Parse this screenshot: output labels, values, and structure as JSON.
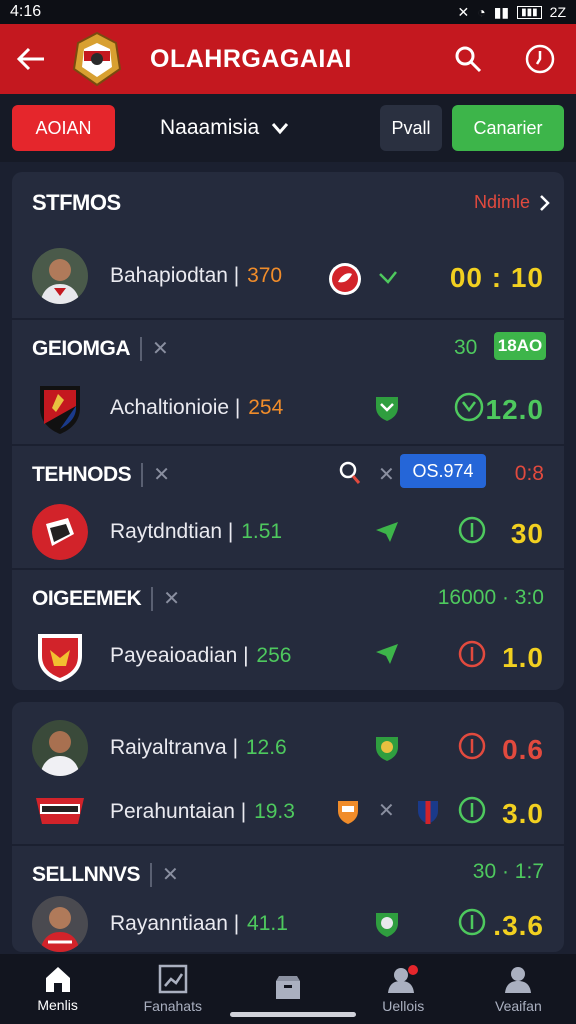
{
  "status_bar": {
    "time": "4:16",
    "battery": "2Z"
  },
  "app_bar": {
    "title": "OLAHRGAGAIAI"
  },
  "filters": {
    "red_pill": "AOIAN",
    "dropdown": "Naaamisia",
    "dark_pill": "Pvall",
    "green_pill": "Canarier"
  },
  "card1": {
    "header": {
      "label": "STFMOS",
      "link": "Ndimle"
    },
    "row1": {
      "name": "Bahapiodtan",
      "num": "370",
      "score": "00 : 10"
    },
    "section2": {
      "label": "GEIOMGA",
      "value": "30",
      "badge": "18AO"
    },
    "row2": {
      "name": "Achaltionioie",
      "num": "254",
      "score": "12.0"
    },
    "section3": {
      "label": "TEHNODS",
      "badge": "OS.974",
      "value": "0:8"
    },
    "row3": {
      "name": "Raytdndtian",
      "num": "1.51",
      "score": "30"
    },
    "section4": {
      "label": "OIGEEMEK",
      "value": "16000 · 3:0"
    },
    "row4": {
      "name": "Payeaioadian",
      "num": "256",
      "score": "1.0"
    }
  },
  "card2": {
    "row1": {
      "name": "Raiyaltranva",
      "num": "12.6",
      "score": "0.6"
    },
    "row2": {
      "name": "Perahuntaian",
      "num": "19.3",
      "score": "3.0"
    },
    "section": {
      "label": "SELLNNVS",
      "value": "30 · 1:7"
    },
    "row3": {
      "name": "Rayanntiaan",
      "num": "41.1",
      "score": ".3.6"
    }
  },
  "nav": [
    "Menlis",
    "Fanahats",
    "",
    "Uellois",
    "Veaifan"
  ]
}
